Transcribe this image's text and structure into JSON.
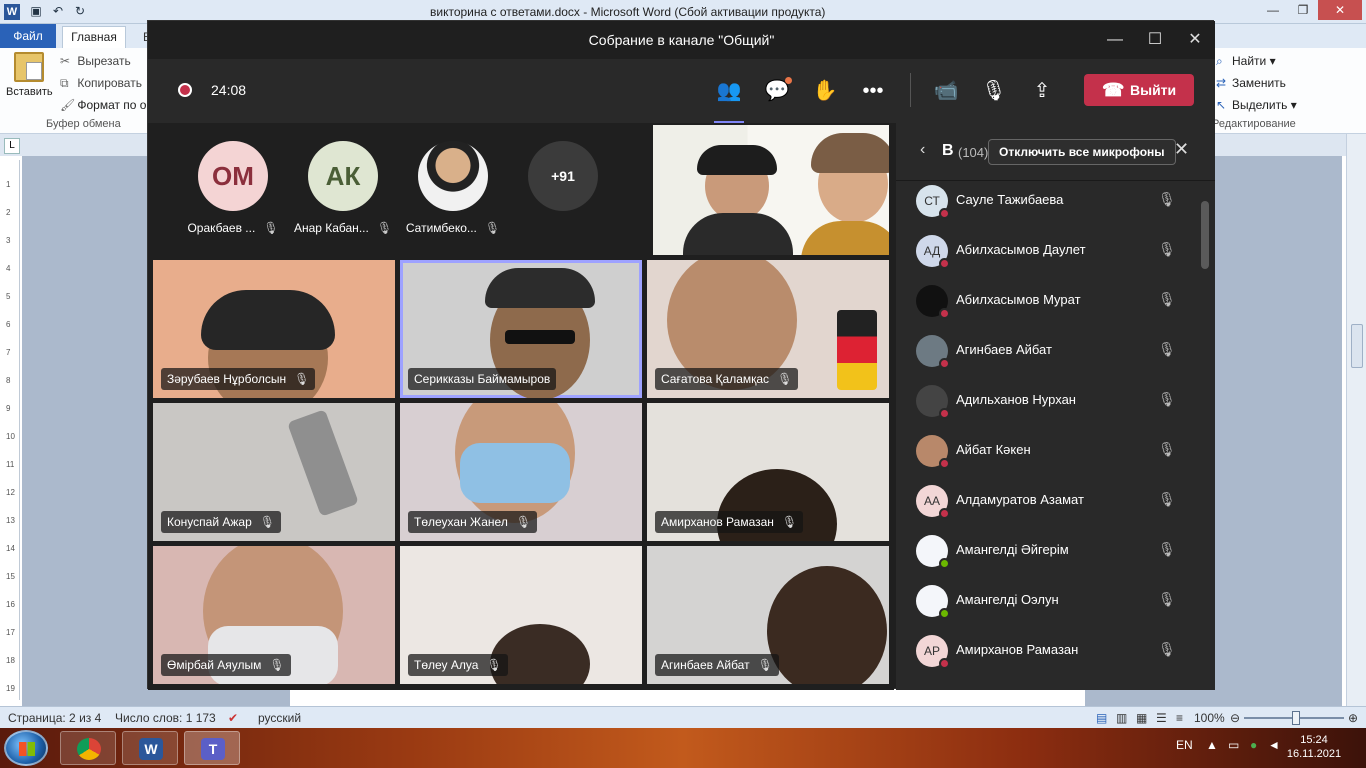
{
  "word": {
    "title": "викторина с ответами.docx  -  Microsoft Word (Сбой активации продукта)",
    "tabs": {
      "file": "Файл",
      "home": "Главная",
      "other": "В"
    },
    "clipboard": {
      "paste": "Вставить",
      "cut": "Вырезать",
      "copy": "Копировать",
      "format_painter": "Формат по о",
      "group_label": "Буфер обмена"
    },
    "editing": {
      "find": "Найти ▾",
      "replace": "Заменить",
      "select": "Выделить ▾",
      "group_label": "Редактирование"
    },
    "status": {
      "page": "Страница: 2 из 4",
      "words": "Число слов: 1 173",
      "language": "русский",
      "zoom": "100%"
    },
    "ruler_numbers": [
      "1",
      "2",
      "3",
      "4",
      "5",
      "6",
      "7",
      "8",
      "9",
      "10",
      "11",
      "12",
      "13",
      "14",
      "15",
      "16",
      "17",
      "18",
      "19"
    ]
  },
  "teams": {
    "window_title": "Собрание в канале \"Общий\"",
    "timer": "24:08",
    "leave_label": "Выйти",
    "strip": [
      {
        "initials": "ОМ",
        "name": "Оракбаев ...",
        "bg": "#f4d4d4",
        "fg": "#8b2f3c"
      },
      {
        "initials": "АК",
        "name": "Анар Кабан...",
        "bg": "#dfe6d2",
        "fg": "#4a5e36"
      },
      {
        "initials": "",
        "name": "Сатимбеко...",
        "bg": "#e6e2dc",
        "fg": "#333"
      }
    ],
    "more_count": "+91",
    "tiles": [
      {
        "name": "Зәрубаев Нұрболсын",
        "bg": "#e8ad8c"
      },
      {
        "name": "Серикказы Баймамыров",
        "bg": "#cfcfcf"
      },
      {
        "name": "Сағатова Қаламқас",
        "bg": "#e2d6cf"
      },
      {
        "name": "Конуспай Ажар",
        "bg": "#c9c7c4"
      },
      {
        "name": "Төлеухан Жанел",
        "bg": "#d8cfd2"
      },
      {
        "name": "Амирханов Рамазан",
        "bg": "#e4e1dc"
      },
      {
        "name": "Өмірбай Аяулым",
        "bg": "#d8b7b2"
      },
      {
        "name": "Төлеу Алуа",
        "bg": "#ece7e3"
      },
      {
        "name": "Агинбаев Айбат",
        "bg": "#d4d3d2"
      }
    ],
    "panel": {
      "header_letter": "В",
      "count": "(104)",
      "mute_all": "Отключить все микрофоны",
      "participants": [
        {
          "initials": "СТ",
          "name": "Сауле Тажибаева",
          "bg": "#d7e3ec",
          "status": "#c4314b"
        },
        {
          "initials": "АД",
          "name": "Абилхасымов Даулет",
          "bg": "#cfd8ea",
          "status": "#c4314b"
        },
        {
          "initials": "",
          "name": "Абилхасымов Мурат",
          "bg": "#111111",
          "status": "#c4314b"
        },
        {
          "initials": "",
          "name": "Агинбаев Айбат",
          "bg": "#6d7a83",
          "status": "#c4314b"
        },
        {
          "initials": "",
          "name": "Адильханов Нурхан",
          "bg": "#444444",
          "status": "#c4314b"
        },
        {
          "initials": "",
          "name": "Айбат Кәкен",
          "bg": "#b8886a",
          "status": "#c4314b"
        },
        {
          "initials": "АА",
          "name": "Алдамуратов Азамат",
          "bg": "#f2d6d6",
          "status": "#c4314b"
        },
        {
          "initials": "",
          "name": "Амангелді Әйгерім",
          "bg": "#f4f6fa",
          "status": "#6bb700"
        },
        {
          "initials": "",
          "name": "Амангелді Оэлун",
          "bg": "#f4f6fa",
          "status": "#6bb700"
        },
        {
          "initials": "АР",
          "name": "Амирханов Рамазан",
          "bg": "#f2d6d6",
          "status": "#c4314b"
        }
      ]
    }
  },
  "taskbar": {
    "lang": "EN",
    "time": "15:24",
    "date": "16.11.2021"
  },
  "colors": {
    "teams_bg": "#1f1f1f",
    "leave_red": "#c4314b",
    "active_outline": "#9ea2ff"
  }
}
